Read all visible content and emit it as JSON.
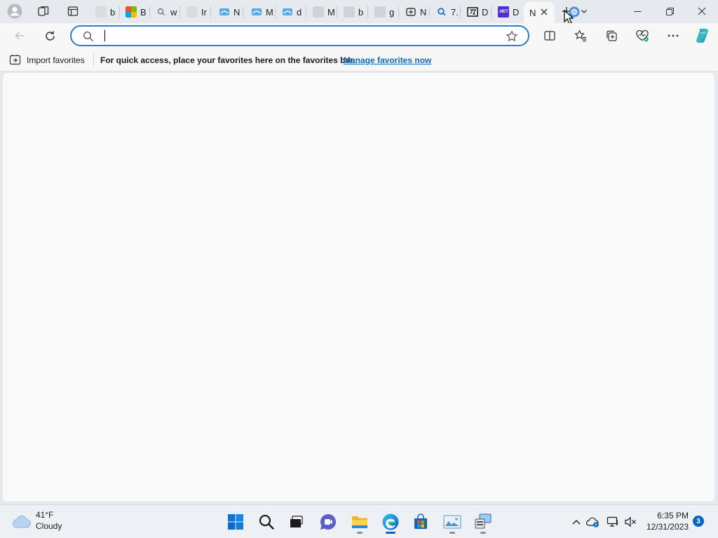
{
  "tabs": [
    {
      "title": "b",
      "favicon": "page-icon"
    },
    {
      "title": "B",
      "favicon": "microsoft-icon"
    },
    {
      "title": "w",
      "favicon": "search-icon"
    },
    {
      "title": "Ir",
      "favicon": "page-icon"
    },
    {
      "title": "N",
      "favicon": "bing-icon"
    },
    {
      "title": "M",
      "favicon": "bing-icon"
    },
    {
      "title": "d",
      "favicon": "bing-icon"
    },
    {
      "title": "M",
      "favicon": "page-icon"
    },
    {
      "title": "b",
      "favicon": "page-icon"
    },
    {
      "title": "g",
      "favicon": "page-icon"
    },
    {
      "title": "N",
      "favicon": "screenshot-icon"
    },
    {
      "title": "7.",
      "favicon": "search-icon"
    },
    {
      "title": "D",
      "favicon": "7zip-icon"
    },
    {
      "title": "D",
      "favicon": "dotnet-icon",
      "favicon_text": ".NET"
    },
    {
      "title": "N",
      "favicon": "none",
      "active": true
    }
  ],
  "address_bar": {
    "value": "",
    "placeholder": ""
  },
  "favorites_bar": {
    "import_label": "Import favorites",
    "message": "For quick access, place your favorites here on the favorites bar.",
    "link_label": "Manage favorites now"
  },
  "taskbar": {
    "weather": {
      "temp": "41°F",
      "condition": "Cloudy"
    },
    "clock": {
      "time": "6:35 PM",
      "date": "12/31/2023"
    },
    "notification_count": "3",
    "apps": [
      "start-icon",
      "search-icon",
      "task-view-icon",
      "teams-chat-icon",
      "file-explorer-icon",
      "edge-icon",
      "microsoft-store-icon",
      "photos-icon",
      "remote-desktop-icon"
    ]
  },
  "colors": {
    "accent": "#0f6cbd",
    "focus_border": "#2b7cd3",
    "tabstrip": "#e6eaef",
    "toolbar": "#f7f7f7"
  }
}
